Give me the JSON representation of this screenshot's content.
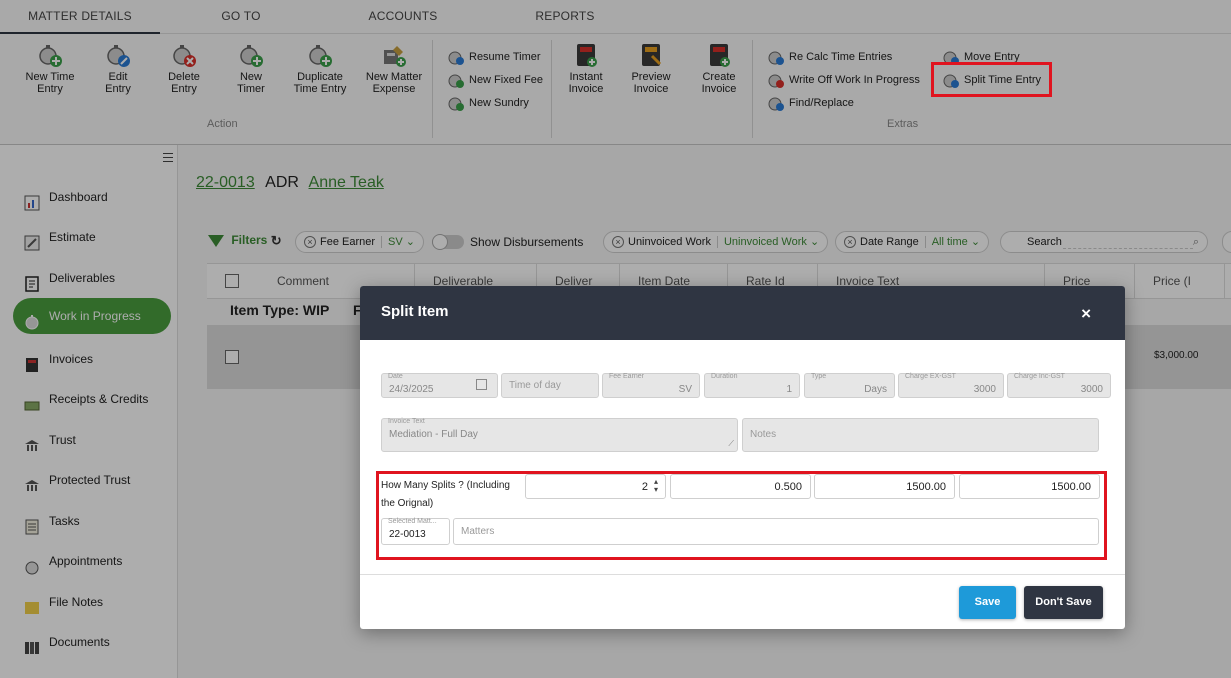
{
  "ribbon": {
    "tabs": [
      "MATTER DETAILS",
      "GO TO",
      "ACCOUNTS",
      "REPORTS"
    ],
    "buttons": [
      {
        "label": "New Time Entry",
        "icon": "stopwatch-add-icon"
      },
      {
        "label": "Edit Entry",
        "icon": "stopwatch-edit-icon"
      },
      {
        "label": "Delete Entry",
        "icon": "stopwatch-delete-icon"
      },
      {
        "label": "New Timer",
        "icon": "stopwatch-icon"
      },
      {
        "label": "Duplicate Time Entry",
        "icon": "stopwatch-duplicate-icon"
      },
      {
        "label": "New Matter Expense",
        "icon": "expense-icon"
      },
      {
        "label": "Instant Invoice",
        "icon": "calculator-add-icon"
      },
      {
        "label": "Preview Invoice",
        "icon": "calculator-preview-icon"
      },
      {
        "label": "Create Invoice",
        "icon": "calculator-create-icon"
      }
    ],
    "small": {
      "resume_timer": "Resume Timer",
      "new_fixed_fee": "New Fixed Fee",
      "new_sundry": "New Sundry",
      "re_calc": "Re Calc Time Entries",
      "write_off": "Write Off Work In Progress",
      "find_replace": "Find/Replace",
      "move_entry": "Move Entry",
      "split_time_entry": "Split Time Entry"
    },
    "groups": {
      "action": "Action",
      "extras": "Extras"
    }
  },
  "sidebar": {
    "items": [
      "Dashboard",
      "Estimate",
      "Deliverables",
      "Work in Progress",
      "Invoices",
      "Receipts & Credits",
      "Trust",
      "Protected Trust",
      "Tasks",
      "Appointments",
      "File Notes",
      "Documents"
    ],
    "active": "Work in Progress"
  },
  "matter": {
    "number": "22-0013",
    "type": "ADR",
    "client": "Anne Teak"
  },
  "filters": {
    "label": "Filters",
    "fee_earner": {
      "label": "Fee Earner",
      "value": "SV"
    },
    "show_disb": "Show Disbursements",
    "uninvoiced": {
      "label": "Uninvoiced Work",
      "value": "Uninvoiced Work"
    },
    "date_range": {
      "label": "Date Range",
      "value": "All time"
    },
    "search": "Search"
  },
  "table": {
    "headers": [
      "Comment",
      "Deliverable",
      "Deliver",
      "Item Date",
      "Rate Id",
      "Invoice Text",
      "Price",
      "Price (I"
    ],
    "group_label": "Item Type: WIP",
    "group_tail": "F",
    "row_price": "$3,000.00"
  },
  "modal": {
    "title": "Split Item",
    "close": "×",
    "date": {
      "label": "Date",
      "value": "24/3/2025"
    },
    "time_of_day": "Time of day",
    "fee_earner": {
      "label": "Fee Earner",
      "value": "SV"
    },
    "duration": {
      "label": "Duration",
      "value": "1"
    },
    "type": {
      "label": "Type",
      "value": "Days"
    },
    "charge_ex": {
      "label": "Charge EX-GST",
      "value": "3000"
    },
    "charge_inc": {
      "label": "Charge Inc-GST",
      "value": "3000"
    },
    "invoice_text": {
      "label": "Invoice Text",
      "value": "Mediation - Full Day"
    },
    "notes_placeholder": "Notes",
    "splits_label": "How Many Splits ? (Including the Orignal)",
    "splits_value": "2",
    "split_duration": "0.500",
    "split_ex": "1500.00",
    "split_inc": "1500.00",
    "selected_matter": {
      "label": "Selected Matt...",
      "value": "22-0013"
    },
    "matters_placeholder": "Matters",
    "save": "Save",
    "dont_save": "Don't Save"
  },
  "colors": {
    "accent_green": "#4a9e3f",
    "header_dark": "#2f3542",
    "save_blue": "#1e9ad9",
    "highlight_red": "#e0141f"
  }
}
